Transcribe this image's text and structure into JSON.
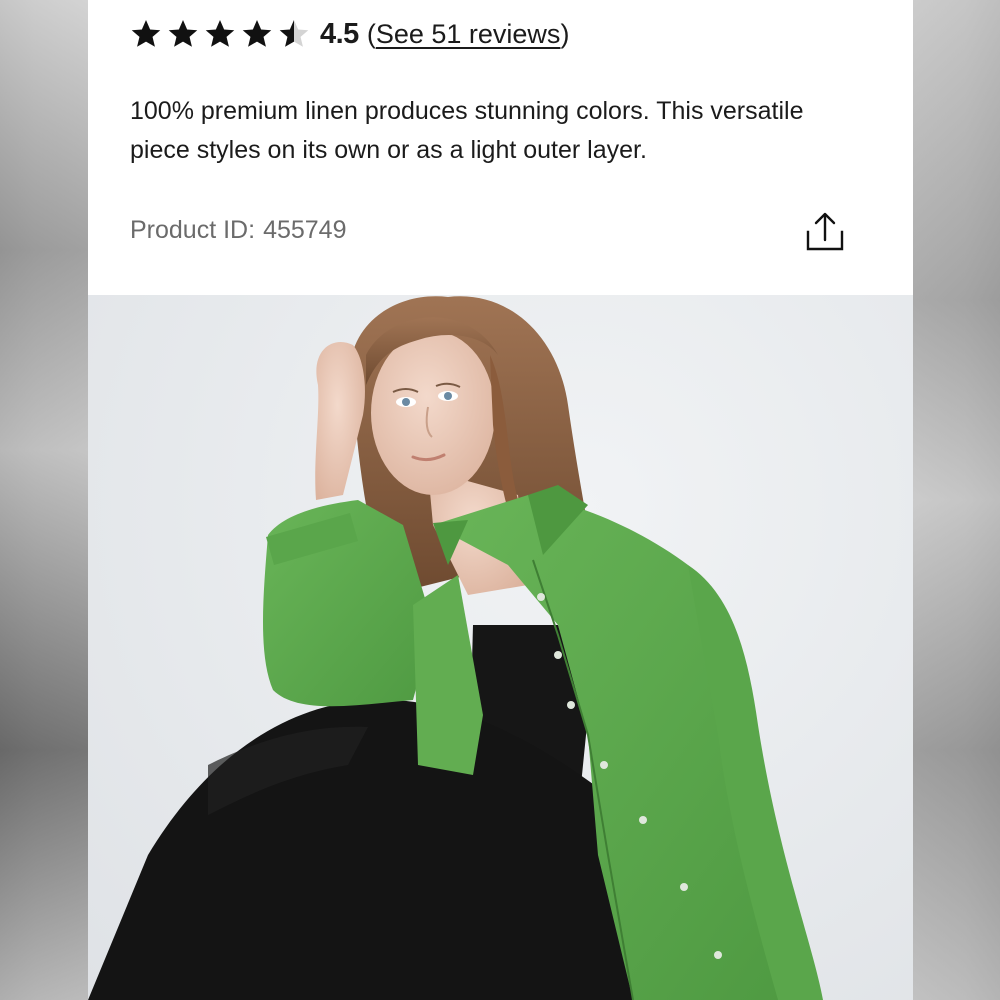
{
  "product": {
    "rating": {
      "value": "4.5",
      "stars_filled": 4.5,
      "stars_total": 5,
      "reviews_open": "(",
      "reviews_label": "See 51 reviews",
      "reviews_close": ")"
    },
    "description": "100% premium linen produces stunning colors. This versatile piece styles on its own or as a light outer layer.",
    "product_id_label": "Product ID:",
    "product_id_value": "455749",
    "share_icon": "share-icon"
  },
  "photo": {
    "subject": "model-photo",
    "colors": {
      "shirt": "#5faa4e",
      "dress": "#151515",
      "hair": "#8a5a3a",
      "background": "#e8ebee"
    }
  }
}
